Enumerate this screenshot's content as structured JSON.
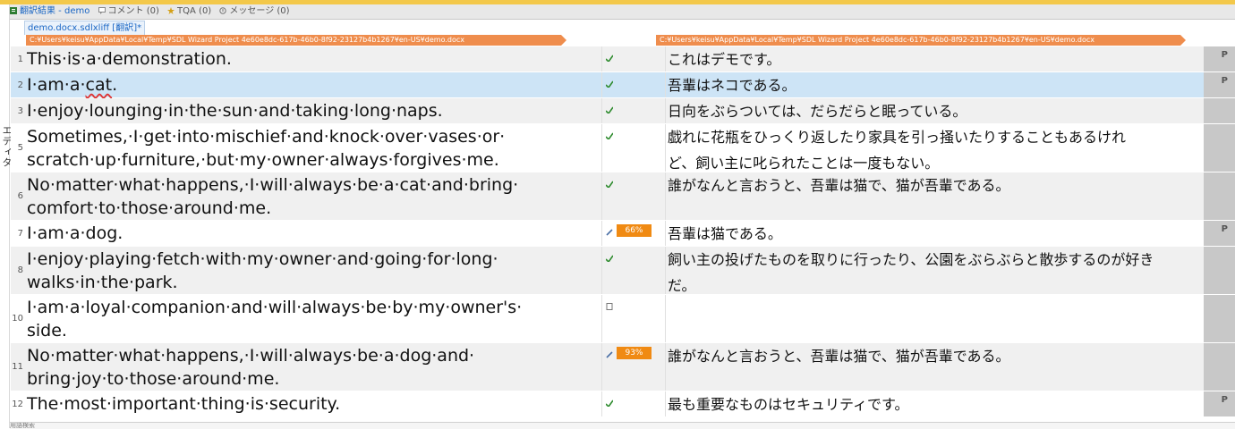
{
  "sidebar": {
    "label": "エディタ"
  },
  "tabs": [
    {
      "label": "翻訳結果 - demo",
      "icon": "translation-results-icon"
    },
    {
      "label": "コメント (0)",
      "icon": "comment-icon"
    },
    {
      "label": "TQA (0)",
      "icon": "tqa-icon"
    },
    {
      "label": "メッセージ (0)",
      "icon": "message-icon"
    }
  ],
  "document_tab": "demo.docx.sdlxliff [翻訳]*",
  "source_path": "C:¥Users¥keisu¥AppData¥Local¥Temp¥SDL Wizard Project 4e60e8dc-617b-46b0-8f92-23127b4b1267¥en-US¥demo.docx",
  "target_path": "C:¥Users¥keisu¥AppData¥Local¥Temp¥SDL Wizard Project 4e60e8dc-617b-46b0-8f92-23127b4b1267¥en-US¥demo.docx",
  "colors": {
    "selected_row": "#cde4f6",
    "match_badge": "#f08a13",
    "path_bar": "#ef8d4d",
    "lock_column": "#c8c8c8"
  },
  "segments": [
    {
      "num": "1",
      "source": [
        "This·is·a·demonstration."
      ],
      "target": [
        "これはデモです。"
      ],
      "status_icon": "translated-check-icon",
      "match": "",
      "lock": "P"
    },
    {
      "num": "2",
      "source": [
        "I·am·a·cat."
      ],
      "target": [
        "吾輩はネコである。"
      ],
      "status_icon": "translated-check-icon",
      "match": "",
      "lock": "P",
      "selected": true
    },
    {
      "num": "3",
      "source": [
        "I·enjoy·lounging·in·the·sun·and·taking·long·naps."
      ],
      "target": [
        "日向をぶらついては、だらだらと眠っている。"
      ],
      "status_icon": "translated-check-icon",
      "match": "",
      "lock": ""
    },
    {
      "num": "5",
      "source": [
        "Sometimes,·I·get·into·mischief·and·knock·over·vases·or·",
        "scratch·up·furniture,·but·my·owner·always·forgives·me."
      ],
      "target": [
        "戯れに花瓶をひっくり返したり家具を引っ掻いたりすることもあるけれ",
        "ど、飼い主に叱られたことは一度もない。"
      ],
      "status_icon": "translated-check-icon",
      "match": "",
      "lock": ""
    },
    {
      "num": "6",
      "source": [
        "No·matter·what·happens,·I·will·always·be·a·cat·and·bring·",
        "comfort·to·those·around·me."
      ],
      "target": [
        "誰がなんと言おうと、吾輩は猫で、猫が吾輩である。"
      ],
      "status_icon": "translated-check-icon",
      "match": "",
      "lock": ""
    },
    {
      "num": "7",
      "source": [
        "I·am·a·dog."
      ],
      "target": [
        "吾輩は猫である。"
      ],
      "status_icon": "draft-pencil-icon",
      "match": "66%",
      "lock": "P"
    },
    {
      "num": "8",
      "source": [
        "I·enjoy·playing·fetch·with·my·owner·and·going·for·long·",
        "walks·in·the·park."
      ],
      "target": [
        "飼い主の投げたものを取りに行ったり、公園をぶらぶらと散歩するのが好き",
        "だ。"
      ],
      "status_icon": "translated-check-icon",
      "match": "",
      "lock": ""
    },
    {
      "num": "10",
      "source": [
        "I·am·a·loyal·companion·and·will·always·be·by·my·owner's·",
        "side."
      ],
      "target": [
        ""
      ],
      "status_icon": "not-translated-page-icon",
      "match": "",
      "lock": ""
    },
    {
      "num": "11",
      "source": [
        "No·matter·what·happens,·I·will·always·be·a·dog·and·",
        "bring·joy·to·those·around·me."
      ],
      "target": [
        "誰がなんと言おうと、吾輩は猫で、猫が吾輩である。"
      ],
      "status_icon": "draft-pencil-icon",
      "match": "93%",
      "lock": ""
    },
    {
      "num": "12",
      "source": [
        "The·most·important·thing·is·security."
      ],
      "target": [
        "最も重要なものはセキュリティです。"
      ],
      "status_icon": "translated-check-icon",
      "match": "",
      "lock": "P"
    }
  ],
  "bottom_bar": {
    "label": "用語検索"
  }
}
